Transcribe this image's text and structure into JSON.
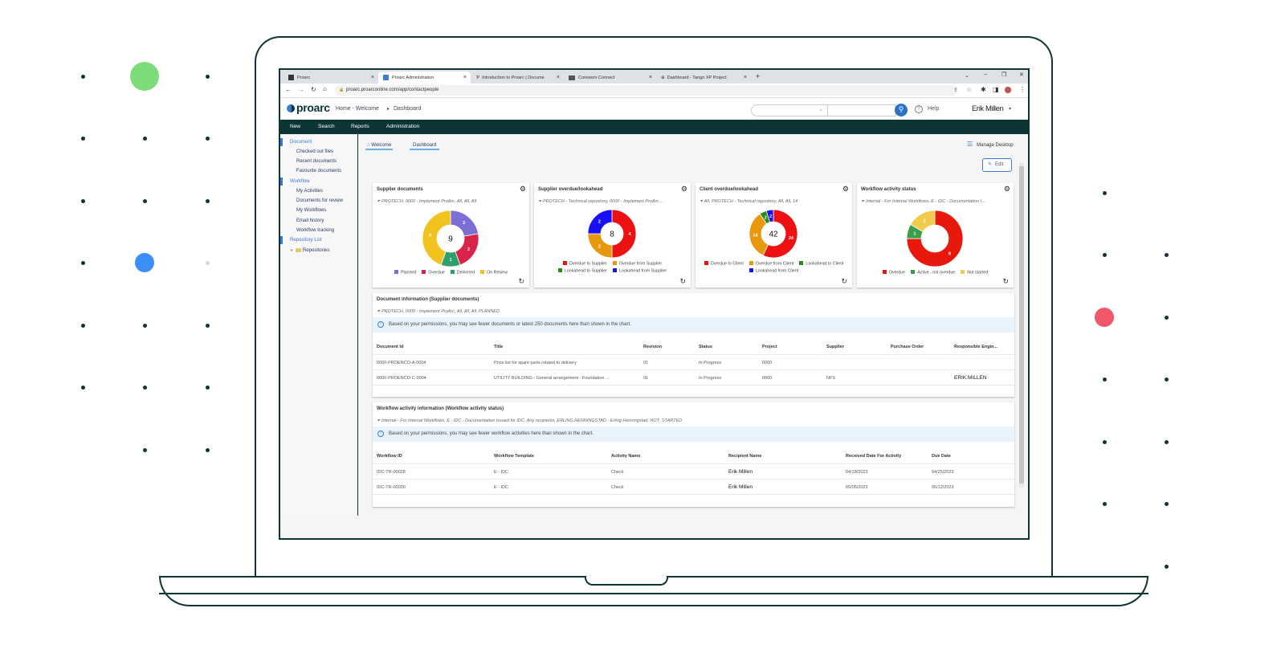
{
  "browser": {
    "tabs": [
      {
        "label": "Proarc",
        "active": false
      },
      {
        "label": "Proarc Administration",
        "active": true
      },
      {
        "label": "Introduction to Proarc | Docume",
        "active": false
      },
      {
        "label": "Coreworx Connect",
        "active": false
      },
      {
        "label": "Dashboard - Tango XP Project",
        "active": false
      }
    ],
    "url": "proarc.proarconline.com/app/contactpeople"
  },
  "header": {
    "logo": "proarc",
    "breadcrumb": {
      "home": "Home - Welcome",
      "separator": "▸",
      "current": "Dashboard"
    },
    "search_select_value": "",
    "search_input_value": "",
    "help_label": "Help",
    "user_name": "Erik Millen"
  },
  "nav": [
    "New",
    "Search",
    "Reports",
    "Administration"
  ],
  "sidebar": {
    "sections": [
      {
        "label": "Document",
        "items": [
          "Checked out files",
          "Recent documents",
          "Favourite documents"
        ]
      },
      {
        "label": "Workflow",
        "items": [
          "My Activities",
          "Documents for review",
          "My Workflows",
          "Email history",
          "Workflow tracking"
        ]
      },
      {
        "label": "Repository List",
        "items": [
          "Repositories"
        ]
      }
    ]
  },
  "main": {
    "tabs": [
      "Welcome",
      "Dashboard"
    ],
    "manage_desktop": "Manage Desktop",
    "edit_label": "Edit"
  },
  "charts": [
    {
      "title": "Supplier documents",
      "filter": "PROTECH, 0000 - Implement ProArc, All, All, All",
      "center_label": "9",
      "chart_data": {
        "type": "pie",
        "donut": true,
        "categories": [
          "Planned",
          "Overdue",
          "Delivered",
          "On Review"
        ],
        "values": [
          2,
          2,
          1,
          4
        ],
        "colors": [
          "#7b6fd6",
          "#d9234a",
          "#2e9e6a",
          "#f2c21f"
        ]
      }
    },
    {
      "title": "Supplier overdue/lookahead",
      "filter": "PROTECH - Technical repository, 0000 - Implement ProArc ...",
      "center_label": "8",
      "chart_data": {
        "type": "pie",
        "donut": true,
        "categories": [
          "Overdue to Supplier",
          "Overdue from Supplier",
          "Lookahead to Supplier",
          "Lookahead from Supplier"
        ],
        "values": [
          4,
          2,
          0,
          2
        ],
        "colors": [
          "#ee1111",
          "#e8980c",
          "#2a8a1a",
          "#1a10f5"
        ]
      }
    },
    {
      "title": "Client overdue/lookahead",
      "filter": "All, PROTECH - Technical repository, All, All, 14",
      "center_label": "42",
      "chart_data": {
        "type": "pie",
        "donut": true,
        "categories": [
          "Overdue to Client",
          "Overdue from Client",
          "Lookahead to Client",
          "Lookahead from Client"
        ],
        "values": [
          24,
          14,
          2,
          2
        ],
        "colors": [
          "#ee1111",
          "#e8980c",
          "#2a8a1a",
          "#1a10f5"
        ]
      }
    },
    {
      "title": "Workflow activity status",
      "filter": "Internal - For Internal Workflows, E - IDC - Documentation I...",
      "center_label": "",
      "chart_data": {
        "type": "pie",
        "donut": true,
        "categories": [
          "Overdue",
          "Active - not overdue",
          "Not started"
        ],
        "values": [
          9,
          1,
          2
        ],
        "colors": [
          "#e8180c",
          "#3a9e4a",
          "#f0cc4a"
        ]
      }
    }
  ],
  "document_info": {
    "title": "Document information (Supplier documents)",
    "filter": "PROTECH, 0000 - Implement ProArc, All, All, All, PLANNED",
    "notice": "Based on your permissions, you may see fewer documents or latest 250 documents here than shown in the chart.",
    "columns": [
      "Document Id",
      "Title",
      "Revision",
      "Status",
      "Project",
      "Supplier",
      "Purchase Order",
      "Responsible Engin..."
    ],
    "rows": [
      [
        "0000-PROENCO-A-0004",
        "Price list for spare parts related to delivery",
        "01",
        "In Progress",
        "0000",
        "",
        "",
        ""
      ],
      [
        "0000-PROENCO-C-0004",
        "UTILITY BUILDING - General arrangement - Foundation ...",
        "01",
        "In Progress",
        "0000",
        "NFS",
        "",
        "ERIK.MILLEN"
      ]
    ]
  },
  "workflow_info": {
    "title": "Workflow activity information (Workflow activity status)",
    "filter": "Internal - For Internal Workflows, E - IDC - Documentation Issued for IDC, Any recipients, ERLING.HENNINGSTAD - Erling Henningstad, NOT_STARTED",
    "notice": "Based on your permissions, you may see fewer workflow activities here than shown in the chart.",
    "columns": [
      "Workflow ID",
      "Workflow Template",
      "Activity Name",
      "Recipient Name",
      "Received Date For Activity",
      "Due Date"
    ],
    "rows": [
      [
        "IDC-TR-00028",
        "E - IDC",
        "Check",
        "Erik Millen",
        "04/18/2023",
        "04/25/2023"
      ],
      [
        "IDC-TR-00030",
        "E - IDC",
        "Check",
        "Erik Millen",
        "05/05/2023",
        "05/12/2023"
      ]
    ]
  },
  "decor_colors": {
    "frame": "#0d3535",
    "dot": "#0d3535",
    "green": "#7ddc7a",
    "blue": "#3b8ef5",
    "red": "#f2566a",
    "grey": "#d8d8d8"
  }
}
